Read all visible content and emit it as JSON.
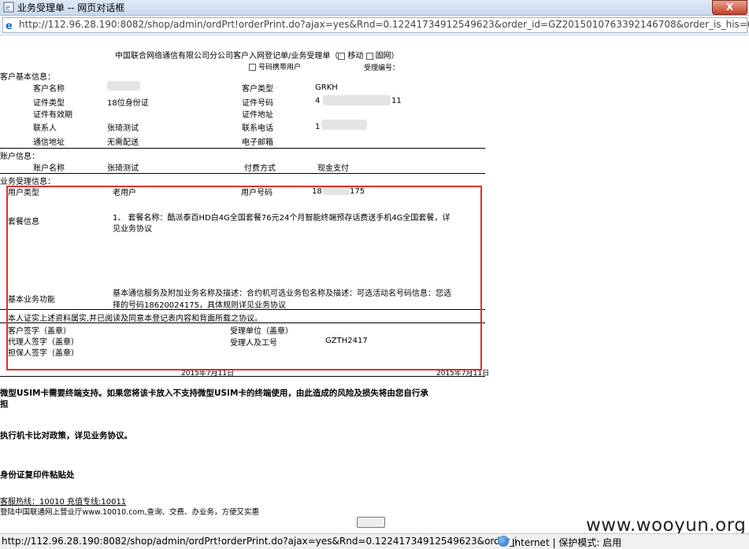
{
  "window": {
    "title": "业务受理单 -- 网页对话框",
    "close_label": "X",
    "url": "http://112.96.28.190:8082/shop/admin/ordPrt!orderPrint.do?ajax=yes&Rnd=0.12241734912549623&order_id=GZ2015010763392146708&order_is_his=0"
  },
  "form": {
    "heading": "中国联合网络通信有限公司分公司客户入网登记单/业务受理单（",
    "heading_tail": "移动",
    "heading_tail2": "固网）",
    "portability_label": "号码携带用户",
    "receipt_no_label": "受理编号：",
    "customer_section": "客户基本信息：",
    "customer": {
      "name_label": "客户名称",
      "type_label": "客户类型",
      "type_value": "GRKH",
      "id_type_label": "证件类型",
      "id_type_value": "18位身份证",
      "id_no_label": "证件号码",
      "id_no_prefix": "4",
      "id_no_suffix": "11",
      "id_valid_label": "证件有效期",
      "id_addr_label": "证件地址",
      "contact_label": "联系人",
      "contact_value": "张琦测试",
      "phone_label": "联系电话",
      "phone_prefix": "1",
      "mail_addr_label": "通信地址",
      "mail_addr_value": "无需配送",
      "email_label": "电子邮箱"
    },
    "account_section": "账户信息：",
    "account": {
      "name_label": "账户名称",
      "name_value": "张琦测试",
      "pay_label": "付费方式",
      "pay_value": "现金支付"
    },
    "business_section": "业务受理信息：",
    "business": {
      "user_type_label": "用户类型",
      "user_type_value": "老用户",
      "user_no_label": "用户号码",
      "user_no_prefix": "18",
      "user_no_suffix": "175",
      "package_label": "套餐信息",
      "package_line1": "1、  套餐名称：酷派泰百HD白4G全国套餐76元24个月智能终端预存话费送手机4G全国套餐，详",
      "package_line2": "见业务协议",
      "basic_label": "基本业务功能",
      "basic_line1": "基本通信服务及附加业务名称及描述：合约机可选业务包名称及描述：可选活动名号码信息：您选",
      "basic_line2": "择的号码18620024175，具体规则详见业务协议"
    },
    "declaration": "本人证实上述资料属实,并已阅读及同意本登记表内容和背面所载之协议。",
    "sign": {
      "customer_sign": "客户签字（盖章）",
      "agent_sign": "代理人签字（盖章）",
      "guarantor_sign": "担保人签字（盖章）",
      "unit_label": "受理单位（盖章）",
      "staff_label": "受理人及工号",
      "staff_value": "GZTH2417",
      "date_left": "2015年7月11日",
      "date_right": "2015年7月11日"
    },
    "notice1_line1": "微型USIM卡需要终端支持。如果您将该卡放入不支持微型USIM卡的终端使用，由此造成的风险及损失将由您自行承",
    "notice1_line2": "担",
    "notice2": "执行机卡比对政策，详见业务协议。",
    "notice3": "身份证复印件粘贴处",
    "hotline": "客服热线：10010 充值专线:10011",
    "website": "登陆中国联通网上营业厅www.10010.com,查询、交费、办业务，方便又实惠"
  },
  "status": {
    "url": "http://112.96.28.190:8082/shop/admin/ordPrt!orderPrint.do?ajax=yes&Rnd=0.12241734912549623&order_i",
    "zone": "Internet | 保护模式: 启用"
  },
  "watermark": "www.wooyun.org",
  "colors": {
    "highlight_box": "#e0302c",
    "title_bar": "#c9d9ee"
  }
}
